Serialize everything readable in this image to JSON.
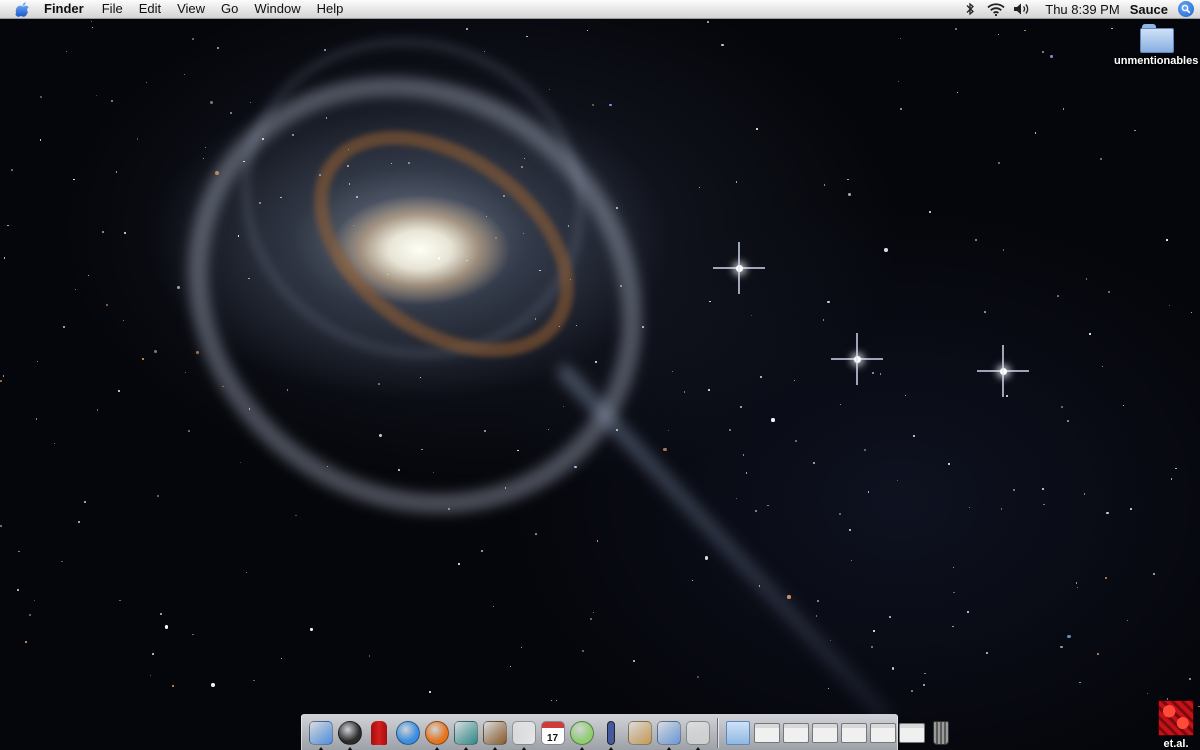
{
  "menubar": {
    "apple_icon": "apple-icon",
    "app_name": "Finder",
    "menus": [
      "File",
      "Edit",
      "View",
      "Go",
      "Window",
      "Help"
    ],
    "status_icons": [
      "bluetooth-icon",
      "wifi-icon",
      "volume-icon"
    ],
    "clock": "Thu 8:39 PM",
    "user": "Sauce",
    "spotlight_icon": "spotlight-icon"
  },
  "desktop": {
    "icons": [
      {
        "label": "unmentionables",
        "icon": "folder-icon"
      },
      {
        "label": "et.al.",
        "icon": "image-file-icon"
      }
    ]
  },
  "dock": {
    "apps": [
      {
        "name": "Finder",
        "icon": "finder-icon",
        "color": "#4f8fe0",
        "running": true
      },
      {
        "name": "Dashboard",
        "icon": "dashboard-icon",
        "color": "#2b2b2b",
        "running": true
      },
      {
        "name": "Fire Hydrant",
        "icon": "hydrant-icon",
        "color": "#d81e1e",
        "running": false
      },
      {
        "name": "Safari",
        "icon": "safari-icon",
        "color": "#3a8de0",
        "running": false
      },
      {
        "name": "Firefox",
        "icon": "firefox-icon",
        "color": "#e4741e",
        "running": true
      },
      {
        "name": "Feather",
        "icon": "feather-icon",
        "color": "#2e8a8a",
        "running": true
      },
      {
        "name": "Preview",
        "icon": "preview-icon",
        "color": "#8a5a2a",
        "running": true
      },
      {
        "name": "TextEdit",
        "icon": "textedit-icon",
        "color": "#e8e8e8",
        "running": true
      },
      {
        "name": "iCal",
        "icon": "ical-icon",
        "color": "#ffffff",
        "running": false,
        "date": "17"
      },
      {
        "name": "iTunes",
        "icon": "itunes-icon",
        "color": "#8fcf6f",
        "running": true
      },
      {
        "name": "Utility",
        "icon": "utility-icon",
        "color": "#445a9a",
        "running": true
      },
      {
        "name": "Address Book",
        "icon": "addressbook-icon",
        "color": "#c89a52",
        "running": false
      },
      {
        "name": "iPhoto",
        "icon": "iphoto-icon",
        "color": "#6a9ad8",
        "running": true
      },
      {
        "name": "Grab",
        "icon": "grab-icon",
        "color": "#cfcfcf",
        "running": true
      }
    ],
    "others": [
      {
        "name": "Applications",
        "icon": "folder-icon",
        "color": "#8fb7e3"
      },
      {
        "name": "Window 1",
        "icon": "minimized-window-icon",
        "color": "#f0f0f0"
      },
      {
        "name": "Window 2",
        "icon": "minimized-window-icon",
        "color": "#f0f0f0"
      },
      {
        "name": "Window 3",
        "icon": "minimized-window-icon",
        "color": "#f0f0f0"
      },
      {
        "name": "Window 4",
        "icon": "minimized-window-icon",
        "color": "#f0f0f0"
      },
      {
        "name": "Window 5",
        "icon": "minimized-window-icon",
        "color": "#f0f0f0"
      },
      {
        "name": "Window 6",
        "icon": "minimized-window-icon",
        "color": "#f0f0f0"
      },
      {
        "name": "Trash",
        "icon": "trash-icon",
        "color": "#888888"
      }
    ]
  }
}
